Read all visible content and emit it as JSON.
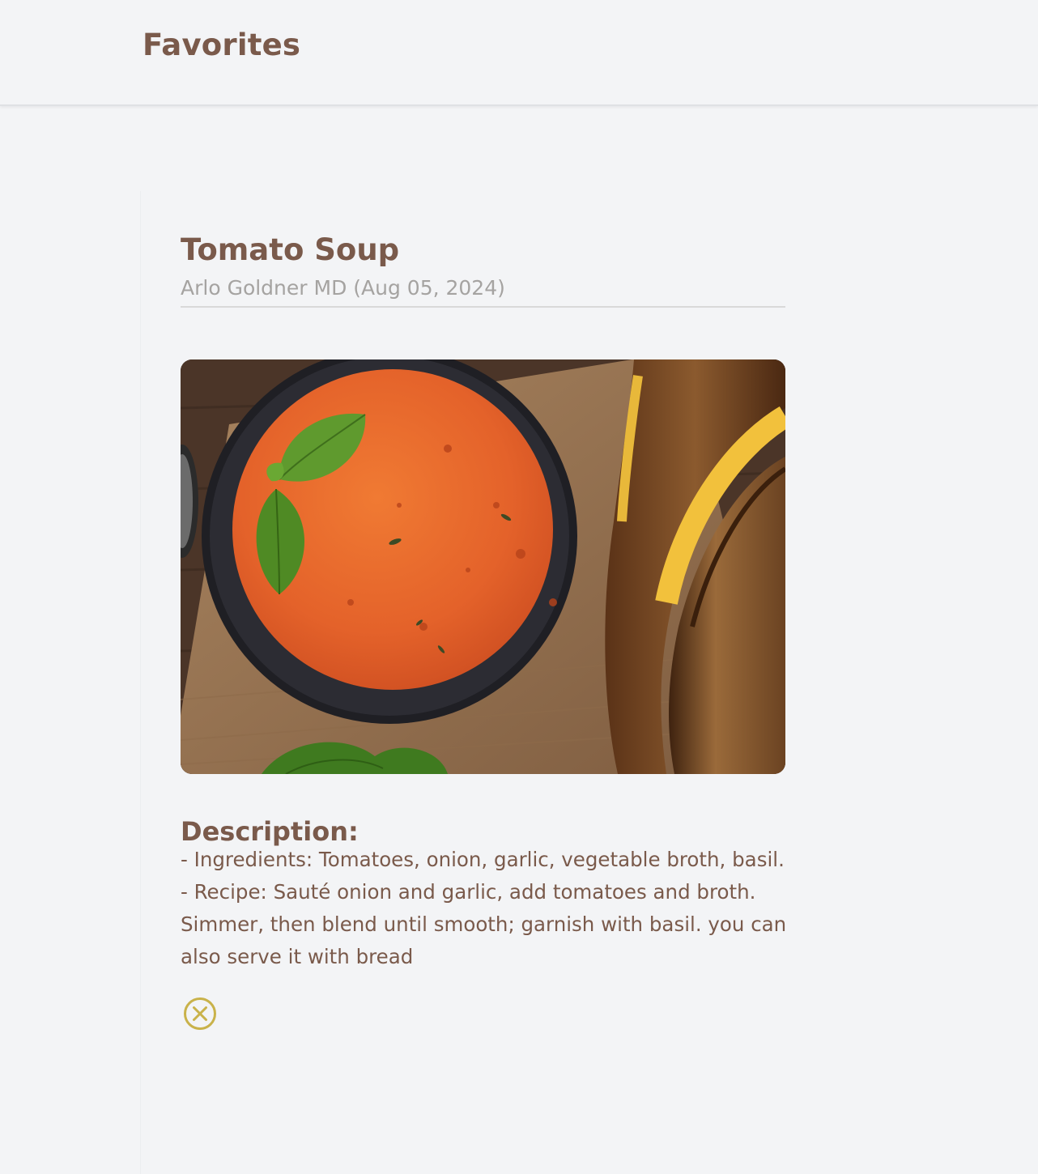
{
  "header": {
    "title": "Favorites"
  },
  "recipe": {
    "title": "Tomato Soup",
    "author_date": "Arlo Goldner MD (Aug 05, 2024)",
    "image_subject": "tomato soup with basil and grilled cheese",
    "description_heading": "Description:",
    "description": "- Ingredients: Tomatoes, onion, garlic, vegetable broth, basil. - Recipe: Sauté onion and garlic, add tomatoes and broth. Simmer, then blend until smooth; garnish with basil. you can also serve it with bread"
  },
  "actions": {
    "remove_icon": "circle-x-icon"
  },
  "colors": {
    "background": "#f3f4f6",
    "primary_text": "#7a5a4b",
    "muted_text": "#a5a3a1",
    "accent": "#c9b24a"
  }
}
